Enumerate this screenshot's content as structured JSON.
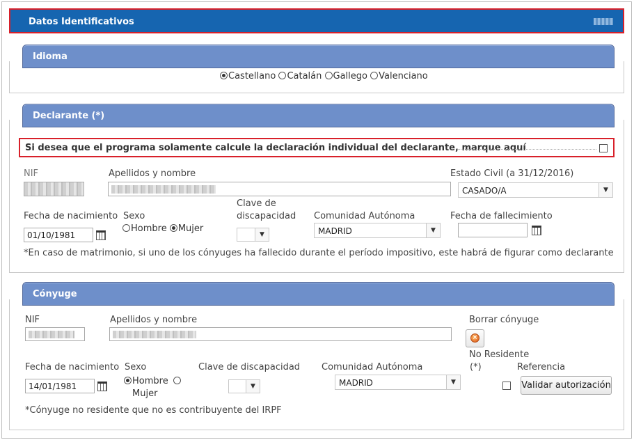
{
  "header": {
    "title": "Datos Identificativos"
  },
  "idioma": {
    "title": "Idioma",
    "options": [
      "Castellano",
      "Catalán",
      "Gallego",
      "Valenciano"
    ],
    "selected": "Castellano"
  },
  "declarante": {
    "title": "Declarante (*)",
    "individual_text": "Si desea que el programa solamente calcule la declaración individual del declarante, marque aquí",
    "nif_label": "NIF",
    "name_label": "Apellidos y nombre",
    "estado_label": "Estado Civil (a 31/12/2016)",
    "estado_value": "CASADO/A",
    "fecha_label": "Fecha de nacimiento",
    "fecha_value": "01/10/1981",
    "sexo_label": "Sexo",
    "hombre": "Hombre",
    "mujer": "Mujer",
    "discapacidad_label_1": "Clave de",
    "discapacidad_label_2": "discapacidad",
    "comunidad_label": "Comunidad Autónoma",
    "comunidad_value": "MADRID",
    "fallecimiento_label": "Fecha de fallecimiento",
    "note": "*En caso de matrimonio, si uno de los cónyuges ha fallecido durante el período impositivo, este habrá de figurar como declarante"
  },
  "conyuge": {
    "title": "Cónyuge",
    "nif_label": "NIF",
    "name_label": "Apellidos y nombre",
    "borrar_label": "Borrar cónyuge",
    "fecha_label": "Fecha de nacimiento",
    "fecha_value": "14/01/1981",
    "sexo_label": "Sexo",
    "hombre": "Hombre",
    "mujer": "Mujer",
    "discapacidad_label": "Clave de discapacidad",
    "comunidad_label": "Comunidad Autónoma",
    "comunidad_value": "MADRID",
    "no_residente_1": "No Residente",
    "no_residente_2": "(*)",
    "referencia_label": "Referencia",
    "validar_button": "Validar autorización",
    "note": "*Cónyuge no residente que no es contribuyente del IRPF"
  }
}
